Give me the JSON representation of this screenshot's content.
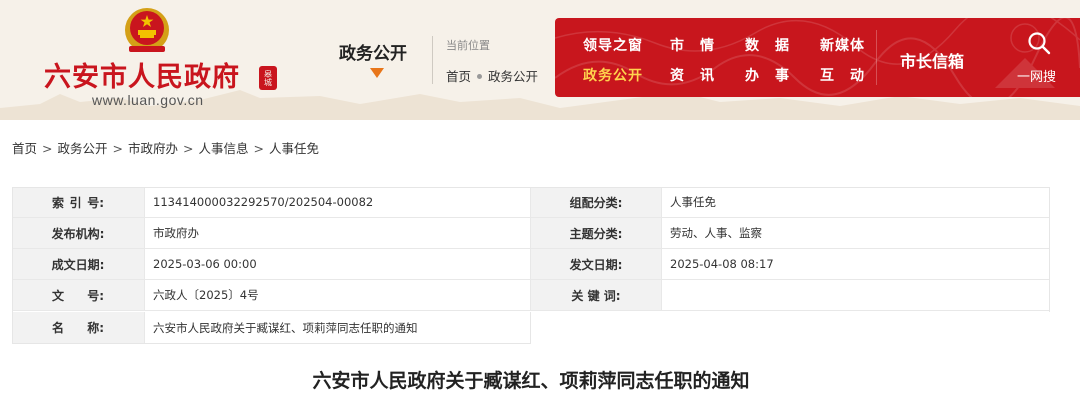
{
  "header": {
    "site_title": "六安市人民政府",
    "site_url": "www.luan.gov.cn",
    "seal_text": "皋城",
    "section_title": "政务公开",
    "location_label": "当前位置",
    "location_path": [
      "首页",
      "政务公开"
    ]
  },
  "nav": {
    "items": [
      {
        "label": "领导之窗",
        "active": false
      },
      {
        "label": "市　情",
        "active": false
      },
      {
        "label": "数　据",
        "active": false
      },
      {
        "label": "新媒体",
        "active": false
      },
      {
        "label": "政务公开",
        "active": true
      },
      {
        "label": "资　讯",
        "active": false
      },
      {
        "label": "办　事",
        "active": false
      },
      {
        "label": "互　动",
        "active": false
      }
    ],
    "mayor_mailbox": "市长信箱",
    "search_label": "一网搜",
    "icon": "search-icon",
    "accent_color": "#c8161d",
    "active_color": "#ffd34d"
  },
  "breadcrumb": [
    "首页",
    "政务公开",
    "市政府办",
    "人事信息",
    "人事任免"
  ],
  "info": {
    "index_no_key": [
      "索",
      "引",
      "号:"
    ],
    "index_no": "113414000032292570/202504-00082",
    "category_key": "组配分类:",
    "category": "人事任免",
    "issuer_key": "发布机构:",
    "issuer": "市政府办",
    "topic_key": "主题分类:",
    "topic": "劳动、人事、监察",
    "created_key": "成文日期:",
    "created": "2025-03-06 00:00",
    "published_key": "发文日期:",
    "published": "2025-04-08 08:17",
    "doc_no_key": [
      "文",
      "号:"
    ],
    "doc_no": "六政人〔2025〕4号",
    "keywords_key": "关 键 词:",
    "keywords": "",
    "name_key": [
      "名",
      "称:"
    ],
    "name": "六安市人民政府关于臧谋红、项莉萍同志任职的通知"
  },
  "document": {
    "title": "六安市人民政府关于臧谋红、项莉萍同志任职的通知"
  }
}
